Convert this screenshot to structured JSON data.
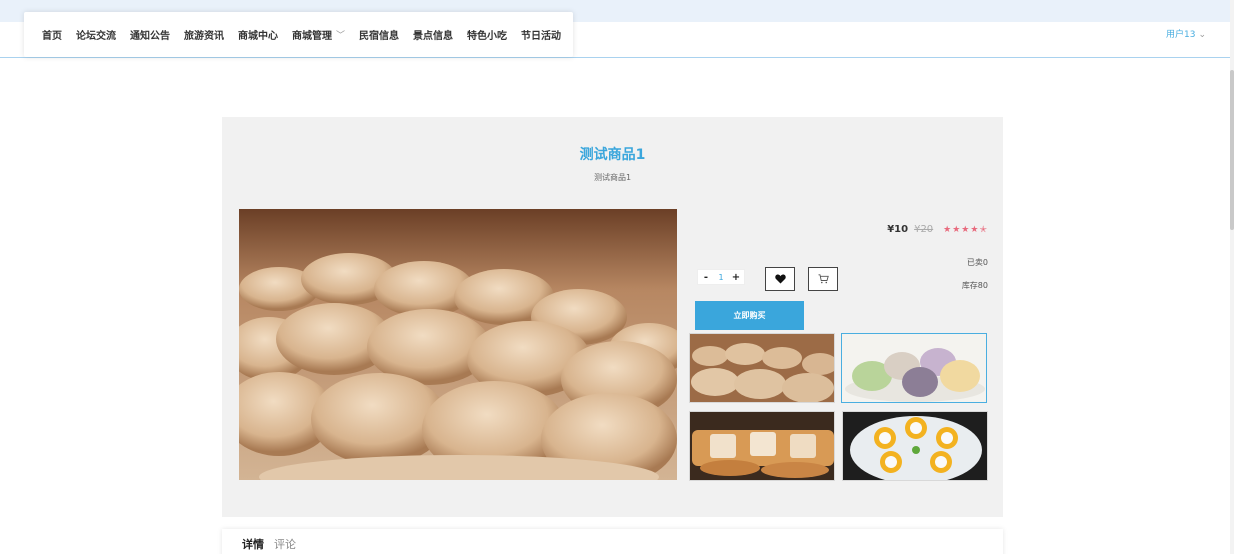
{
  "nav": {
    "items": [
      {
        "label": "首页"
      },
      {
        "label": "论坛交流"
      },
      {
        "label": "通知公告"
      },
      {
        "label": "旅游资讯"
      },
      {
        "label": "商城中心"
      },
      {
        "label": "商城管理",
        "has_dropdown": true
      },
      {
        "label": "民宿信息"
      },
      {
        "label": "景点信息"
      },
      {
        "label": "特色小吃"
      },
      {
        "label": "节日活动"
      }
    ]
  },
  "user": {
    "label": "用户13"
  },
  "product": {
    "title": "测试商品1",
    "subtitle": "测试商品1",
    "price": "¥10",
    "original_price": "¥20",
    "rating_stars": 4.5,
    "sold_label": "已卖0",
    "stock_label": "库存80",
    "quantity": "1",
    "buy_label": "立即购买"
  },
  "tabs": [
    {
      "label": "详情",
      "active": true
    },
    {
      "label": "评论",
      "active": false
    }
  ],
  "colors": {
    "accent": "#3aa6dc",
    "star": "#e86a7d",
    "panel": "#f1f1f1"
  },
  "icons": {
    "favorite": "heart-icon",
    "cart": "cart-icon",
    "dropdown": "chevron-down-icon"
  }
}
